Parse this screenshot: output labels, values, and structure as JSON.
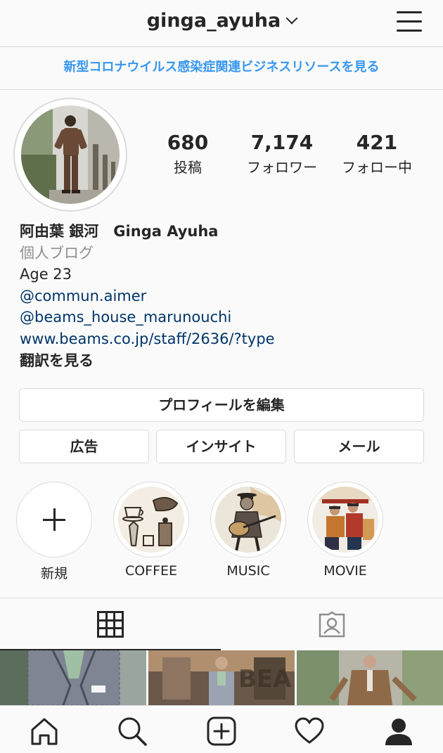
{
  "header": {
    "username": "ginga_ayuha"
  },
  "banner": {
    "text": "新型コロナウイルス感染症関連ビジネスリソースを見る"
  },
  "stats": [
    {
      "value": "680",
      "label": "投稿"
    },
    {
      "value": "7,174",
      "label": "フォロワー"
    },
    {
      "value": "421",
      "label": "フォロー中"
    }
  ],
  "bio": {
    "name": "阿由葉 銀河　Ginga Ayuha",
    "category": "個人ブログ",
    "line1": "Age 23",
    "link1": "@commun.aimer",
    "link2": "@beams_house_marunouchi",
    "link3": "www.beams.co.jp/staff/2636/?type",
    "translate": "翻訳を見る"
  },
  "buttons": {
    "edit_profile": "プロフィールを編集",
    "ads": "広告",
    "insights": "インサイト",
    "email": "メール"
  },
  "highlights": [
    {
      "label": "新規"
    },
    {
      "label": "COFFEE"
    },
    {
      "label": "MUSIC"
    },
    {
      "label": "MOVIE"
    }
  ],
  "colors": {
    "link": "#003569",
    "banner": "#3897f0",
    "text": "#262626",
    "muted": "#8e8e8e",
    "border": "#dbdbdb"
  }
}
